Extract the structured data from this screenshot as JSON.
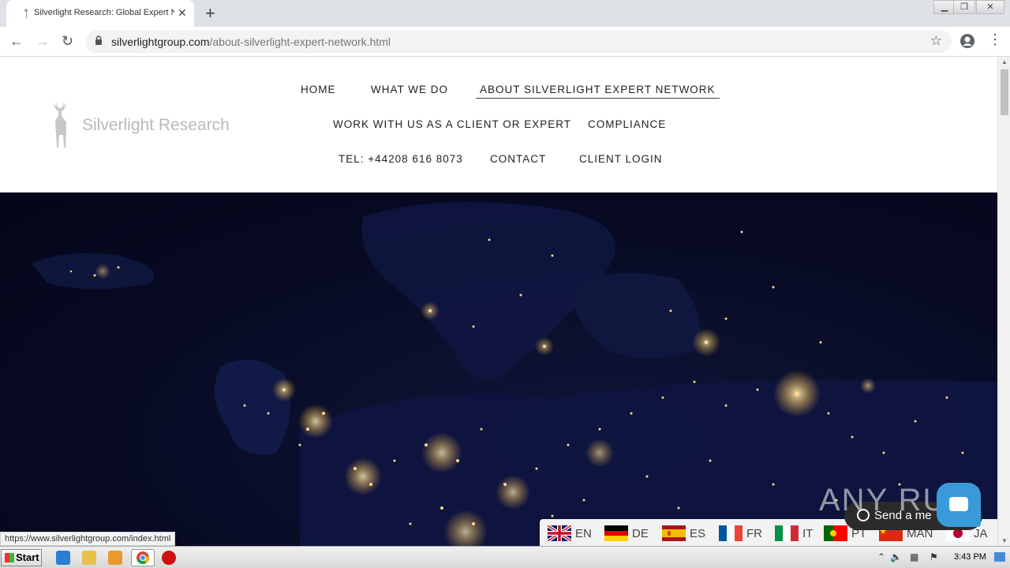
{
  "browser": {
    "tab_title": "Silverlight Research: Global Expert N",
    "new_tab": "+",
    "close_tab": "✕",
    "url_domain": "silverlightgroup.com",
    "url_path": "/about-silverlight-expert-network.html",
    "status_link": "https://www.silverlightgroup.com/index.html"
  },
  "site": {
    "logo_text": "Silverlight Research",
    "nav": {
      "home": "HOME",
      "what_we_do": "WHAT WE DO",
      "about": "ABOUT SILVERLIGHT EXPERT NETWORK",
      "work_with_us": "WORK WITH US AS A CLIENT OR EXPERT",
      "compliance": "COMPLIANCE",
      "tel": "TEL: +44208 616 8073",
      "contact": "CONTACT",
      "client_login": "CLIENT LOGIN"
    },
    "active_nav": "about"
  },
  "languages": [
    {
      "code": "EN",
      "flag": "uk"
    },
    {
      "code": "DE",
      "flag": "de"
    },
    {
      "code": "ES",
      "flag": "es"
    },
    {
      "code": "FR",
      "flag": "fr"
    },
    {
      "code": "IT",
      "flag": "it"
    },
    {
      "code": "PT",
      "flag": "pt"
    },
    {
      "code": "MAN",
      "flag": "cn"
    },
    {
      "code": "JA",
      "flag": "jp"
    }
  ],
  "chat": {
    "label": "Send a me",
    "watermark": "ANY RUN"
  },
  "taskbar": {
    "start_label": "Start",
    "clock": "3:43 PM"
  },
  "colors": {
    "tabbar": "#dee1e6",
    "hero_bg": "#070a22",
    "city_lights": "#ffd98a",
    "chat_button": "#3a9ad9"
  }
}
